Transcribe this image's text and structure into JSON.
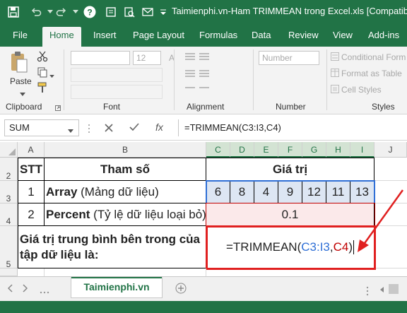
{
  "window": {
    "title": "Taimienphi.vn-Ham TRIMMEAN trong Excel.xls  [Compatibility"
  },
  "tabs": [
    "File",
    "Home",
    "Insert",
    "Page Layout",
    "Formulas",
    "Data",
    "Review",
    "View",
    "Add-ins"
  ],
  "ribbon": {
    "paste_label": "Paste",
    "font_size": "12",
    "number_format": "Number",
    "styles": [
      "Conditional Form",
      "Format as Table",
      "Cell Styles"
    ],
    "groups": [
      "Clipboard",
      "Font",
      "Alignment",
      "Number",
      "Styles"
    ]
  },
  "formula_bar": {
    "name_box": "SUM",
    "fx": "fx",
    "formula": "=TRIMMEAN(C3:I3,C4)"
  },
  "columns": [
    "A",
    "B",
    "C",
    "D",
    "E",
    "F",
    "G",
    "H",
    "I",
    "J"
  ],
  "rows": [
    "2",
    "3",
    "4",
    "5"
  ],
  "sheet": {
    "stt_header": "STT",
    "param_header": "Tham số",
    "value_header": "Giá trị",
    "row3_stt": "1",
    "row3_name": "Array",
    "row3_desc": " (Mảng dữ liệu)",
    "row3_values": [
      "6",
      "8",
      "4",
      "9",
      "12",
      "11",
      "13"
    ],
    "row4_stt": "2",
    "row4_name": "Percent",
    "row4_desc": " (Tỷ lệ dữ liệu loại bỏ)",
    "row4_value": "0.1",
    "row5_label": "Giá trị trung bình bên trong của tập dữ liệu là:",
    "formula_prefix": "=TRIMMEAN(",
    "formula_ref1": "C3:I3",
    "formula_comma": ",",
    "formula_ref2": "C4",
    "formula_suffix": ")"
  },
  "sheet_tabs": [
    "Taimienphi.vn"
  ],
  "colors": {
    "excel_green": "#217346",
    "ref_blue": "#2f6fd6",
    "ref_red": "#c00000",
    "row4_fill": "#fbe9ea",
    "highlight_red": "#e02020"
  }
}
